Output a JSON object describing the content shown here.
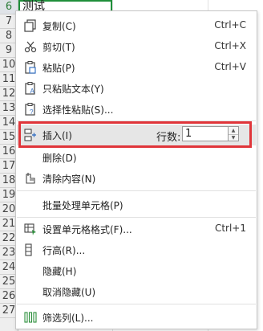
{
  "sheet": {
    "active_cell_text": "测试",
    "row_numbers": [
      "6",
      "7",
      "8",
      "9",
      "10",
      "11",
      "12",
      "13",
      "14",
      "15",
      "16",
      "17",
      "18",
      "19",
      "20",
      "21",
      "22",
      "23",
      "24",
      "25",
      "26",
      "27"
    ]
  },
  "menu": {
    "copy": {
      "label": "复制(C)",
      "shortcut": "Ctrl+C"
    },
    "cut": {
      "label": "剪切(T)",
      "shortcut": "Ctrl+X"
    },
    "paste": {
      "label": "粘贴(P)",
      "shortcut": "Ctrl+V"
    },
    "paste_text": {
      "label": "只粘贴文本(Y)"
    },
    "paste_special": {
      "label": "选择性粘贴(S)..."
    },
    "insert": {
      "label": "插入(I)",
      "rows_label": "行数:",
      "rows_value": "1"
    },
    "delete": {
      "label": "删除(D)"
    },
    "clear": {
      "label": "清除内容(N)"
    },
    "batch": {
      "label": "批量处理单元格(P)"
    },
    "format": {
      "label": "设置单元格格式(F)...",
      "shortcut": "Ctrl+1"
    },
    "row_height": {
      "label": "行高(R)..."
    },
    "hide": {
      "label": "隐藏(H)"
    },
    "unhide": {
      "label": "取消隐藏(U)"
    },
    "filter_col": {
      "label": "筛选列(L)..."
    }
  },
  "colors": {
    "highlight_border": "#e0353a",
    "active_cell_border": "#1f8f3a"
  }
}
